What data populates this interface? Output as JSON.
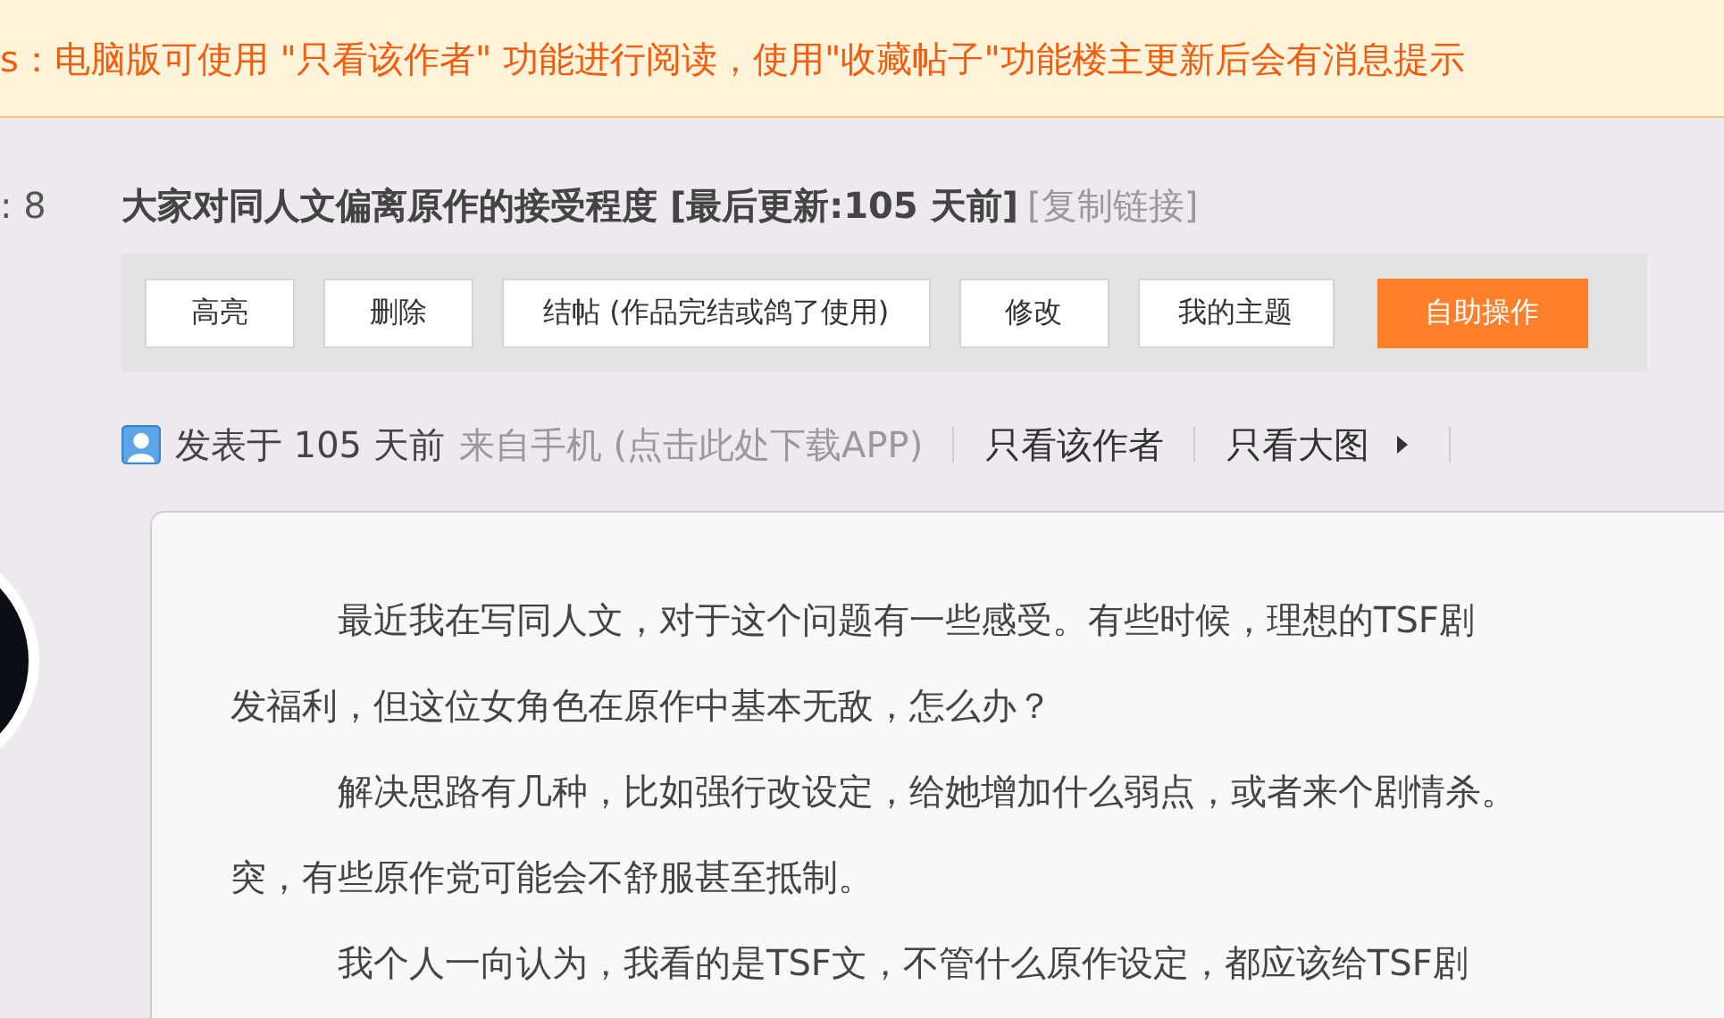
{
  "notice": "s：电脑版可使用 \"只看该作者\" 功能进行阅读，使用\"收藏帖子\"功能楼主更新后会有消息提示",
  "side_count": ": 8",
  "thread": {
    "title": "大家对同人文偏离原作的接受程度",
    "updated": "[最后更新:105 天前]",
    "copy_link": "[复制链接]"
  },
  "toolbar": [
    {
      "label": "高亮",
      "kind": "normal"
    },
    {
      "label": "删除",
      "kind": "normal"
    },
    {
      "label": "结帖 (作品完结或鸽了使用)",
      "kind": "normal"
    },
    {
      "label": "修改",
      "kind": "normal"
    },
    {
      "label": "我的主题",
      "kind": "normal"
    },
    {
      "label": "自助操作",
      "kind": "primary"
    }
  ],
  "post_meta": {
    "posted": "发表于 105 天前",
    "source": "来自手机 (点击此处下载APP)",
    "only_author": "只看该作者",
    "only_images": "只看大图"
  },
  "post": {
    "lines": [
      {
        "text": "最近我在写同人文，对于这个问题有一些感受。有些时候，理想的TSF剧",
        "kind": "indent"
      },
      {
        "text": "发福利，但这位女角色在原作中基本无敌，怎么办？",
        "kind": "continuation"
      },
      {
        "text": "解决思路有几种，比如强行改设定，给她增加什么弱点，或者来个剧情杀。",
        "kind": "indent"
      },
      {
        "text": "突，有些原作党可能会不舒服甚至抵制。",
        "kind": "continuation"
      },
      {
        "text": "我个人一向认为，我看的是TSF文，不管什么原作设定，都应该给TSF剧",
        "kind": "indent"
      }
    ]
  }
}
